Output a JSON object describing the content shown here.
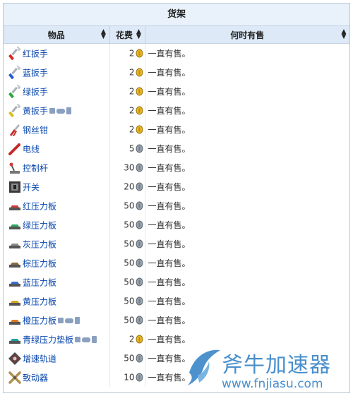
{
  "table": {
    "caption": "货架",
    "headers": {
      "item": "物品",
      "cost": "花费",
      "when": "何时有售"
    },
    "rows": [
      {
        "name": "红扳手",
        "cost": "2",
        "coin": "gold",
        "when": "一直有售。",
        "icon": "red-wrench",
        "color": "#d42a2a",
        "platform": false
      },
      {
        "name": "蓝扳手",
        "cost": "2",
        "coin": "gold",
        "when": "一直有售。",
        "icon": "blue-wrench",
        "color": "#2a5ad4",
        "platform": false
      },
      {
        "name": "绿扳手",
        "cost": "2",
        "coin": "gold",
        "when": "一直有售。",
        "icon": "green-wrench",
        "color": "#2aa83a",
        "platform": false
      },
      {
        "name": "黄扳手",
        "cost": "2",
        "coin": "gold",
        "when": "一直有售。",
        "icon": "yellow-wrench",
        "color": "#d8c020",
        "platform": true
      },
      {
        "name": "钢丝钳",
        "cost": "2",
        "coin": "gold",
        "when": "一直有售。",
        "icon": "wire-cutter",
        "color": "#c42a2a",
        "platform": false
      },
      {
        "name": "电线",
        "cost": "5",
        "coin": "silver",
        "when": "一直有售。",
        "icon": "wire",
        "color": "#c42a2a",
        "platform": false
      },
      {
        "name": "控制杆",
        "cost": "30",
        "coin": "silver",
        "when": "一直有售。",
        "icon": "lever",
        "color": "#666666",
        "platform": false
      },
      {
        "name": "开关",
        "cost": "20",
        "coin": "silver",
        "when": "一直有售。",
        "icon": "switch",
        "color": "#333333",
        "platform": false
      },
      {
        "name": "红压力板",
        "cost": "50",
        "coin": "silver",
        "when": "一直有售。",
        "icon": "red-pressure-plate",
        "color": "#d43a3a",
        "platform": false
      },
      {
        "name": "绿压力板",
        "cost": "50",
        "coin": "silver",
        "when": "一直有售。",
        "icon": "green-pressure-plate",
        "color": "#2aa860",
        "platform": false
      },
      {
        "name": "灰压力板",
        "cost": "50",
        "coin": "silver",
        "when": "一直有售。",
        "icon": "gray-pressure-plate",
        "color": "#8a8a8a",
        "platform": false
      },
      {
        "name": "棕压力板",
        "cost": "50",
        "coin": "silver",
        "when": "一直有售。",
        "icon": "brown-pressure-plate",
        "color": "#8a6a40",
        "platform": false
      },
      {
        "name": "蓝压力板",
        "cost": "50",
        "coin": "silver",
        "when": "一直有售。",
        "icon": "blue-pressure-plate",
        "color": "#3a6ad4",
        "platform": false
      },
      {
        "name": "黄压力板",
        "cost": "50",
        "coin": "silver",
        "when": "一直有售。",
        "icon": "yellow-pressure-plate",
        "color": "#d8a820",
        "platform": false
      },
      {
        "name": "橙压力板",
        "cost": "50",
        "coin": "silver",
        "when": "一直有售。",
        "icon": "orange-pressure-plate",
        "color": "#e07a20",
        "platform": true
      },
      {
        "name": "青绿压力垫板",
        "cost": "2",
        "coin": "gold",
        "when": "一直有售。",
        "icon": "teal-pressure-pad",
        "color": "#20a0a0",
        "platform": true
      },
      {
        "name": "增速轨道",
        "cost": "50",
        "coin": "silver",
        "when": "一直有售。",
        "icon": "booster-track",
        "color": "#7a3a3a",
        "platform": false
      },
      {
        "name": "致动器",
        "cost": "10",
        "coin": "silver",
        "when": "一直有售。",
        "icon": "actuator",
        "color": "#b09050",
        "platform": false
      }
    ]
  },
  "watermark": {
    "name": "斧牛加速器",
    "url": "www.fnjiasu.com",
    "color": "#3a86c8"
  },
  "colors": {
    "header_bg": "#dde9f6",
    "caption_bg": "#e9f2fb",
    "link": "#0645ad",
    "gold_coin": "#e8b820",
    "silver_coin": "#9aa4ae"
  }
}
